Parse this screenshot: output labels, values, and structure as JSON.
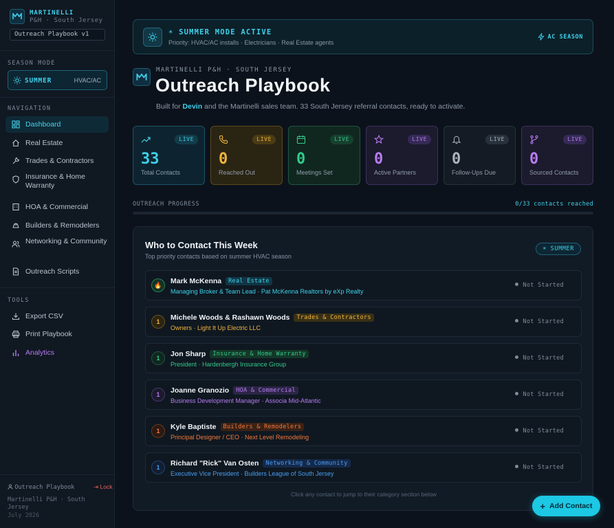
{
  "sidebar": {
    "brand_name": "MARTINELLI",
    "brand_sub": "P&H · South Jersey",
    "version": "Outreach Playbook v1",
    "season_heading": "SEASON MODE",
    "season_label": "SUMMER",
    "season_value": "HVAC/AC",
    "nav_heading": "NAVIGATION",
    "nav": [
      {
        "label": "Dashboard",
        "icon": "dashboard-icon"
      },
      {
        "label": "Real Estate",
        "icon": "home-icon"
      },
      {
        "label": "Trades & Contractors",
        "icon": "wrench-icon"
      },
      {
        "label": "Insurance & Home Warranty",
        "icon": "shield-icon"
      },
      {
        "label": "HOA & Commercial",
        "icon": "building-icon"
      },
      {
        "label": "Builders & Remodelers",
        "icon": "hardhat-icon"
      },
      {
        "label": "Networking & Community",
        "icon": "users-icon"
      },
      {
        "label": "Outreach Scripts",
        "icon": "document-icon"
      }
    ],
    "tools_heading": "TOOLS",
    "tools": [
      {
        "label": "Export CSV",
        "icon": "download-icon"
      },
      {
        "label": "Print Playbook",
        "icon": "printer-icon"
      },
      {
        "label": "Analytics",
        "icon": "bar-chart-icon"
      }
    ],
    "footer_user": "Outreach Playbook",
    "footer_lock": "Lock",
    "footer_org": "Martinelli P&H · South Jersey",
    "footer_date": "July 2026"
  },
  "banner": {
    "title": "SUMMER MODE ACTIVE",
    "subtitle": "Priority: HVAC/AC installs · Electricians · Real Estate agents",
    "right_label": "AC SEASON"
  },
  "hero": {
    "eyebrow": "MARTINELLI P&H · SOUTH JERSEY",
    "title": "Outreach Playbook",
    "desc_prefix": "Built for ",
    "desc_name": "Devin",
    "desc_suffix": " and the Martinelli sales team. 33 South Jersey referral contacts, ready to activate."
  },
  "stats": [
    {
      "value": "33",
      "label": "Total Contacts",
      "badge": "LIVE",
      "icon": "trending-up-icon",
      "color": "#3fd0ea"
    },
    {
      "value": "0",
      "label": "Reached Out",
      "badge": "LIVE",
      "icon": "phone-icon",
      "color": "#f0b43c"
    },
    {
      "value": "0",
      "label": "Meetings Set",
      "badge": "LIVE",
      "icon": "calendar-icon",
      "color": "#34c98a"
    },
    {
      "value": "0",
      "label": "Active Partners",
      "badge": "LIVE",
      "icon": "star-icon",
      "color": "#b77cf0"
    },
    {
      "value": "0",
      "label": "Follow-Ups Due",
      "badge": "LIVE",
      "icon": "bell-icon",
      "color": "#aab4bf"
    },
    {
      "value": "0",
      "label": "Sourced Contacts",
      "badge": "LIVE",
      "icon": "git-branch-icon",
      "color": "#b77cf0"
    }
  ],
  "progress": {
    "label": "OUTREACH PROGRESS",
    "value_text": "0/33 contacts reached",
    "fraction": 0
  },
  "week": {
    "title": "Who to Contact This Week",
    "subtitle": "Top priority contacts based on summer HVAC season",
    "badge": "☀ SUMMER",
    "contacts": [
      {
        "priority": "🔥",
        "name": "Mark McKenna",
        "tag": "Real Estate",
        "role": "Managing Broker & Team Lead · Pat McKenna Realtors by eXp Realty",
        "status": "Not Started",
        "color": "#3fd0ea"
      },
      {
        "priority": "1",
        "name": "Michele Woods & Rashawn Woods",
        "tag": "Trades & Contractors",
        "role": "Owners · Light It Up Electric LLC",
        "status": "Not Started",
        "color": "#f0b43c"
      },
      {
        "priority": "1",
        "name": "Jon Sharp",
        "tag": "Insurance & Home Warranty",
        "role": "President · Hardenbergh Insurance Group",
        "status": "Not Started",
        "color": "#34c98a"
      },
      {
        "priority": "1",
        "name": "Joanne Granozio",
        "tag": "HOA & Commercial",
        "role": "Business Development Manager · Associa Mid-Atlantic",
        "status": "Not Started",
        "color": "#b77cf0"
      },
      {
        "priority": "1",
        "name": "Kyle Baptiste",
        "tag": "Builders & Remodelers",
        "role": "Principal Designer / CEO · Next Level Remodeling",
        "status": "Not Started",
        "color": "#f07a3c"
      },
      {
        "priority": "1",
        "name": "Richard \"Rick\" Van Osten",
        "tag": "Networking & Community",
        "role": "Executive Vice President · Builders League of South Jersey",
        "status": "Not Started",
        "color": "#4a9cf0"
      }
    ],
    "hint": "Click any contact to jump to their category section below"
  },
  "fab": {
    "label": "Add Contact"
  }
}
